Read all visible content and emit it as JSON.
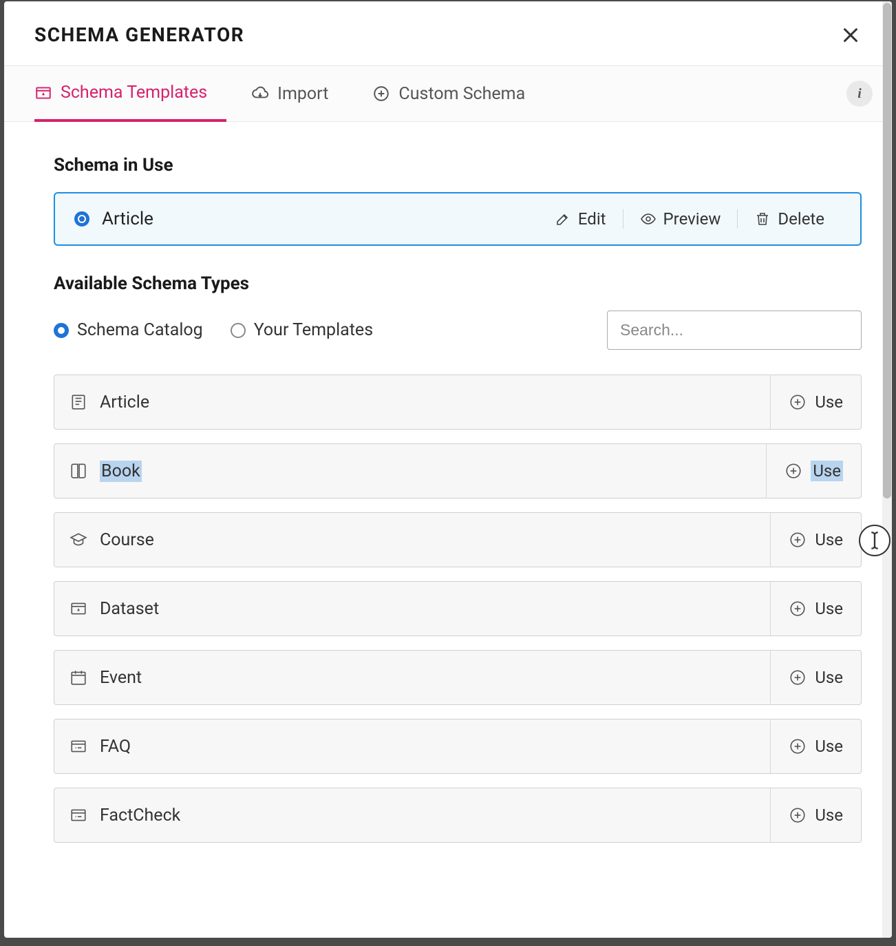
{
  "header": {
    "title": "SCHEMA GENERATOR"
  },
  "tabs": {
    "templates": "Schema Templates",
    "import": "Import",
    "custom": "Custom Schema"
  },
  "sections": {
    "in_use_title": "Schema in Use",
    "available_title": "Available Schema Types"
  },
  "in_use": {
    "name": "Article",
    "edit": "Edit",
    "preview": "Preview",
    "delete": "Delete"
  },
  "filter": {
    "catalog": "Schema Catalog",
    "templates": "Your Templates",
    "search_placeholder": "Search..."
  },
  "use_label": "Use",
  "schemas": [
    {
      "name": "Article",
      "highlighted": false
    },
    {
      "name": "Book",
      "highlighted": true
    },
    {
      "name": "Course",
      "highlighted": false
    },
    {
      "name": "Dataset",
      "highlighted": false
    },
    {
      "name": "Event",
      "highlighted": false
    },
    {
      "name": "FAQ",
      "highlighted": false
    },
    {
      "name": "FactCheck",
      "highlighted": false
    }
  ]
}
